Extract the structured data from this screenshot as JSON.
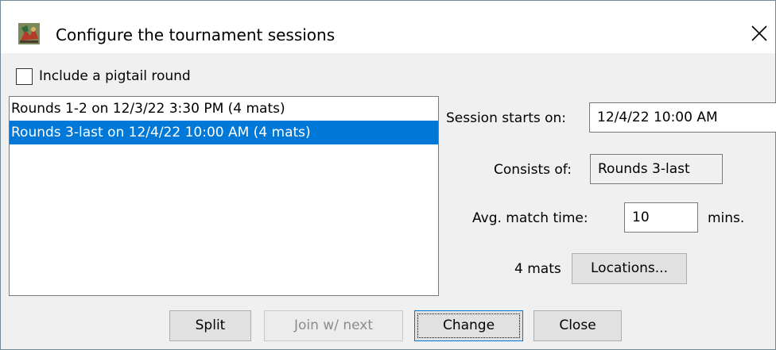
{
  "window": {
    "title": "Configure the tournament sessions",
    "app_icon": "tournament-app-icon",
    "close_icon": "close-icon"
  },
  "pigtail": {
    "label": "Include a pigtail round",
    "checked": false
  },
  "sessions": {
    "items": [
      {
        "label": "Rounds 1-2 on 12/3/22 3:30 PM (4 mats)",
        "selected": false
      },
      {
        "label": "Rounds 3-last on 12/4/22 10:00 AM (4 mats)",
        "selected": true
      }
    ]
  },
  "details": {
    "starts_label": "Session starts on:",
    "starts_value": "12/4/22 10:00 AM",
    "consists_label": "Consists of:",
    "consists_value": "Rounds 3-last",
    "match_time_label": "Avg. match time:",
    "match_time_value": "10",
    "match_time_unit": "mins.",
    "mats_label": "4 mats",
    "locations_button": "Locations..."
  },
  "buttons": {
    "split": "Split",
    "join_next": "Join w/ next",
    "change": "Change",
    "close": "Close"
  },
  "colors": {
    "selection": "#0078d7",
    "button_face": "#e1e1e1",
    "dialog_background": "#f0f0f0"
  }
}
